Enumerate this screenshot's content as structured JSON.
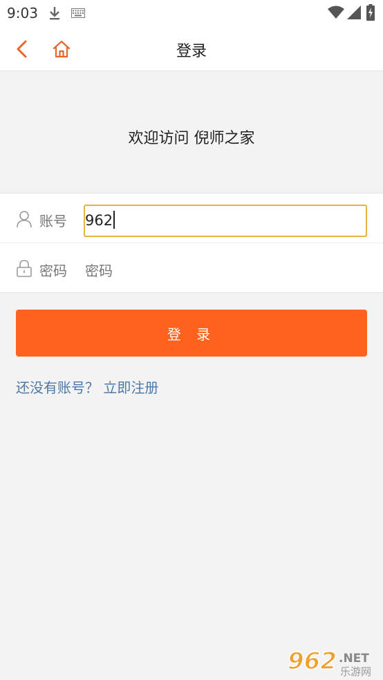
{
  "status_bar": {
    "time": "9:03",
    "icons": [
      "download-icon",
      "keyboard-icon",
      "wifi-icon",
      "signal-icon",
      "battery-icon"
    ]
  },
  "nav": {
    "title": "登录",
    "back_icon": "chevron-left-icon",
    "home_icon": "home-icon"
  },
  "welcome": "欢迎访问 倪师之家",
  "form": {
    "account_label": "账号",
    "account_value": "962",
    "password_label": "密码",
    "password_placeholder": "密码"
  },
  "login_button": "登 录",
  "register": "还没有账号？ 立即注册",
  "watermark": {
    "number": "962",
    "net": ".NET",
    "text": "乐游网"
  },
  "colors": {
    "accent": "#ff621c",
    "nav_icon": "#e8652a",
    "link": "#4e78a6",
    "input_focus_border": "#e0b544",
    "background": "#f3f3f3"
  }
}
